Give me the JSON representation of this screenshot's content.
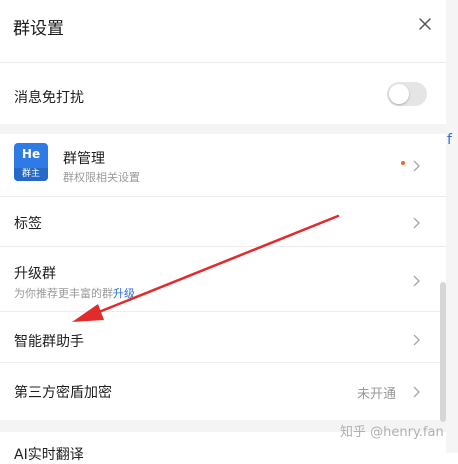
{
  "header": {
    "title": "群设置",
    "close_icon": "close-icon"
  },
  "mute_row": {
    "label": "消息免打扰",
    "toggle_on": false
  },
  "group_manage": {
    "avatar_initials": "He",
    "avatar_badge": "群主",
    "title": "群管理",
    "subtitle": "群权限相关设置",
    "has_dot": true
  },
  "rows": {
    "tags": "标签",
    "upgrade_label": "升级群",
    "upgrade_sub": "为你推荐更丰富的群",
    "upgrade_sub_link": "升级",
    "assistant": "智能群助手",
    "third_party": "第三方密盾加密",
    "third_party_value": "未开通",
    "partial_row": "AI实时翻译"
  },
  "edge_char": "f",
  "watermark": "知乎 @henry.fan",
  "colors": {
    "accent": "#2e6fd1",
    "arrow": "#e22b2b",
    "dot": "#e8692c"
  }
}
